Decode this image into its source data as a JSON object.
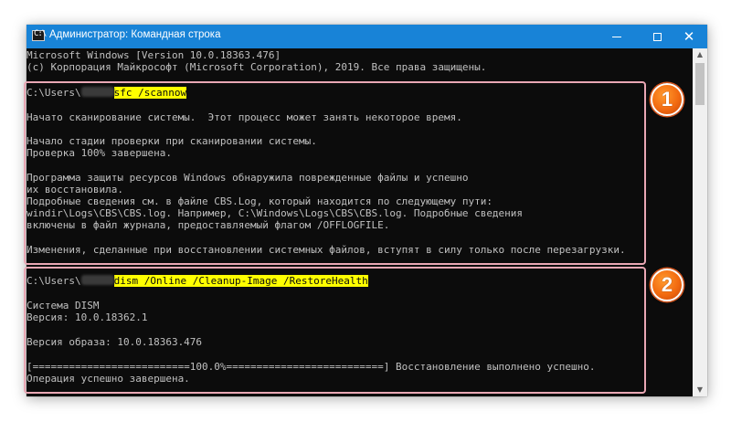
{
  "window": {
    "title": "Администратор: Командная строка",
    "icon": "cmd-icon",
    "icon_glyph": "C:\\",
    "controls": {
      "minimize": "minimize-icon",
      "maximize": "maximize-icon",
      "close": "close-icon",
      "close_glyph": "✕"
    },
    "colors": {
      "titlebar": "#1883d7",
      "console_bg": "#0c0c0c",
      "console_text": "#c0c0c0",
      "highlight": "#ffff00",
      "callout_border": "#e9a7b4",
      "badge": "#f26a10"
    }
  },
  "console": {
    "header": [
      "Microsoft Windows [Version 10.0.18363.476]",
      "(c) Корпорация Майкрософт (Microsoft Corporation), 2019. Все права защищены."
    ],
    "block1": {
      "prompt": "C:\\Users\\",
      "command": "sfc /scannow",
      "output": [
        "Начато сканирование системы.  Этот процесс может занять некоторое время.",
        "Начало стадии проверки при сканировании системы.",
        "Проверка 100% завершена.",
        "Программа защиты ресурсов Windows обнаружила поврежденные файлы и успешно",
        "их восстановила.",
        "Подробные сведения см. в файле CBS.Log, который находится по следующему пути:",
        "windir\\Logs\\CBS\\CBS.log. Например, C:\\Windows\\Logs\\CBS\\CBS.log. Подробные сведения",
        "включены в файл журнала, предоставляемый флагом /OFFLOGFILE.",
        "Изменения, сделанные при восстановлении системных файлов, вступят в силу только после перезагрузки."
      ]
    },
    "block2": {
      "prompt": "C:\\Users\\",
      "command": "dism /Online /Cleanup-Image /RestoreHealth",
      "output": [
        "Система DISM",
        "Версия: 10.0.18362.1",
        "Версия образа: 10.0.18363.476",
        "[==========================100.0%==========================] Восстановление выполнено успешно.",
        "Операция успешно завершена."
      ]
    }
  },
  "callouts": [
    "1",
    "2"
  ],
  "scrollbar": {
    "up_glyph": "▲",
    "down_glyph": "▼"
  }
}
